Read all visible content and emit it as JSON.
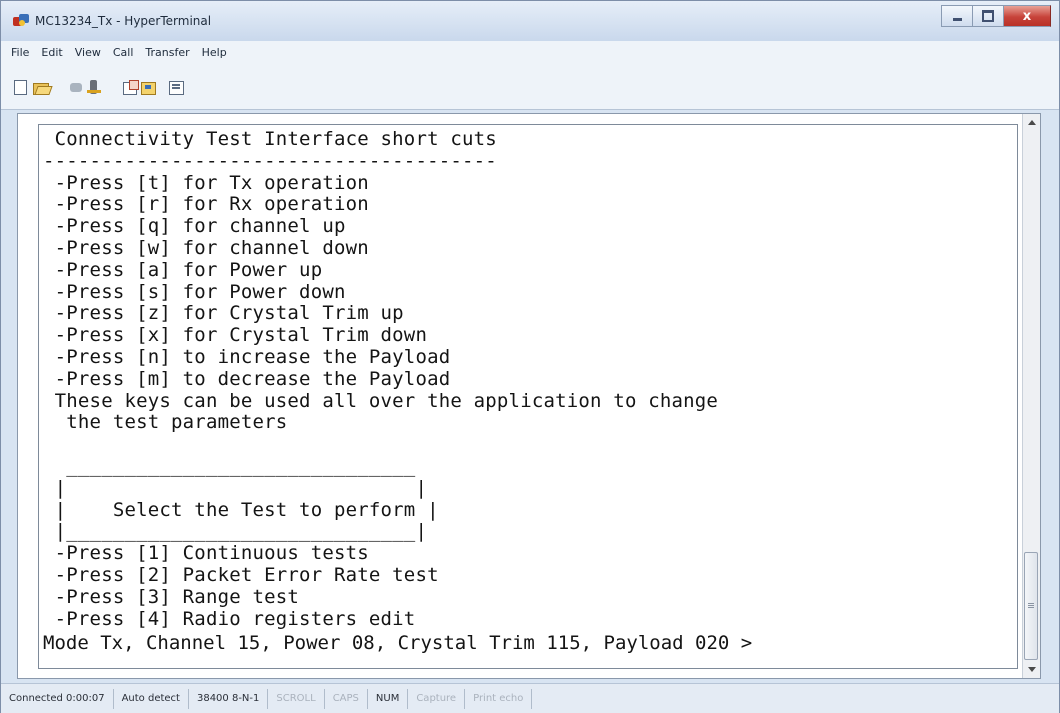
{
  "window": {
    "title": "MC13234_Tx - HyperTerminal",
    "close_glyph": "x"
  },
  "menu": [
    "File",
    "Edit",
    "View",
    "Call",
    "Transfer",
    "Help"
  ],
  "toolbar": {
    "icons": [
      "new-connection-icon",
      "open-icon",
      "connect-icon",
      "disconnect-icon",
      "send-icon",
      "receive-icon",
      "properties-icon"
    ]
  },
  "terminal": {
    "lines": [
      " Connectivity Test Interface short cuts",
      "---------------------------------------",
      " -Press [t] for Tx operation",
      " -Press [r] for Rx operation",
      " -Press [q] for channel up",
      " -Press [w] for channel down",
      " -Press [a] for Power up",
      " -Press [s] for Power down",
      " -Press [z] for Crystal Trim up",
      " -Press [x] for Crystal Trim down",
      " -Press [n] to increase the Payload",
      " -Press [m] to decrease the Payload",
      " These keys can be used all over the application to change",
      "  the test parameters",
      "",
      "  ______________________________",
      " |                              |",
      " |    Select the Test to perform |",
      " |______________________________|",
      " -Press [1] Continuous tests",
      " -Press [2] Packet Error Rate test",
      " -Press [3] Range test",
      " -Press [4] Radio registers edit"
    ],
    "prompt": "Mode Tx, Channel 15, Power 08, Crystal Trim 115, Payload 020 >"
  },
  "status": {
    "items": [
      {
        "text": "Connected 0:00:07",
        "active": true
      },
      {
        "text": "Auto detect",
        "active": true
      },
      {
        "text": "38400 8-N-1",
        "active": true
      },
      {
        "text": "SCROLL",
        "active": false
      },
      {
        "text": "CAPS",
        "active": false
      },
      {
        "text": "NUM",
        "active": true
      },
      {
        "text": "Capture",
        "active": false
      },
      {
        "text": "Print echo",
        "active": false
      }
    ]
  }
}
